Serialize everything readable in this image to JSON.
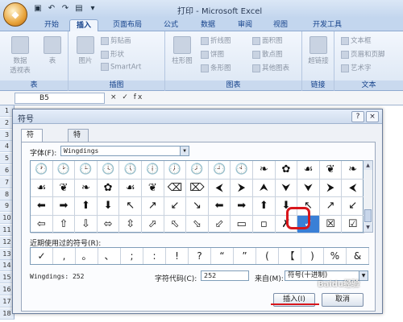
{
  "window": {
    "title": "打印 - Microsoft Excel"
  },
  "quick_access": {
    "icons": [
      "save-icon",
      "undo-icon",
      "redo-icon",
      "print-preview-icon",
      "customize-icon"
    ]
  },
  "ribbon_tabs": [
    "开始",
    "插入",
    "页面布局",
    "公式",
    "数据",
    "审阅",
    "视图",
    "开发工具"
  ],
  "ribbon_active_tab": "插入",
  "ribbon": {
    "groups": {
      "table": {
        "label": "表",
        "btn1": "数据\n透视表",
        "btn2": "表"
      },
      "illustrations": {
        "label": "插图",
        "picture": "图片",
        "clipart": "剪贴画",
        "shapes": "形状",
        "smartart": "SmartArt"
      },
      "charts": {
        "label": "图表",
        "column": "柱形图",
        "line": "折线图",
        "pie": "饼图",
        "bar": "条形图",
        "area": "面积图",
        "scatter": "散点图",
        "other": "其他图表"
      },
      "links": {
        "label": "链接",
        "hyperlink": "超链接"
      },
      "text": {
        "label": "文本",
        "textbox": "文本框",
        "header_footer": "页眉和页脚",
        "wordart": "艺术字"
      }
    }
  },
  "formula_bar": {
    "name_box": "B5",
    "icons": "× ✓ fx"
  },
  "row_numbers": [
    "1",
    "2",
    "3",
    "4",
    "5",
    "6",
    "7",
    "8",
    "9",
    "10",
    "11",
    "12",
    "13",
    "14",
    "15",
    "16",
    "17",
    "18"
  ],
  "dialog": {
    "title": "符号",
    "help_btn": "?",
    "close_btn": "×",
    "tabs": [
      "符号(S)",
      "特殊字符(P)"
    ],
    "font_label": "字体(F):",
    "font_value": "Wingdings",
    "symbols": [
      [
        "🕐",
        "🕑",
        "🕒",
        "🕓",
        "🕔",
        "🕕",
        "🕖",
        "🕗",
        "🕘",
        "🕙",
        "❧",
        "✿",
        "☙",
        "❦",
        "❧"
      ],
      [
        "☙",
        "❦",
        "❧",
        "✿",
        "☙",
        "❦",
        "⌫",
        "⌦",
        "⮜",
        "⮞",
        "⮝",
        "⮟",
        "⮟",
        "⮞",
        "⮜"
      ],
      [
        "⬅",
        "➡",
        "⬆",
        "⬇",
        "↖",
        "↗",
        "↙",
        "↘",
        "⬅",
        "➡",
        "⬆",
        "⬇",
        "↖",
        "↗",
        "↙"
      ],
      [
        "⇦",
        "⇧",
        "⇩",
        "⬄",
        "⇳",
        "⬀",
        "⬁",
        "⬂",
        "⬃",
        "▭",
        "▫",
        "✗",
        "✓",
        "☒",
        "☑"
      ]
    ],
    "selected_symbol": "✓",
    "recent_label": "近期使用过的符号(R):",
    "recent_symbols": [
      "✓",
      ",",
      "。",
      "、",
      ";",
      ":",
      "!",
      "?",
      "“",
      "”",
      "(",
      "【",
      ")",
      "%",
      "&"
    ],
    "font_info": "Wingdings: 252",
    "char_code_label": "字符代码(C):",
    "char_code_value": "252",
    "from_label": "来自(M):",
    "from_value": "符号(十进制)",
    "insert_btn": "插入(I)",
    "cancel_btn": "取消"
  },
  "watermark": "Baidu经验"
}
